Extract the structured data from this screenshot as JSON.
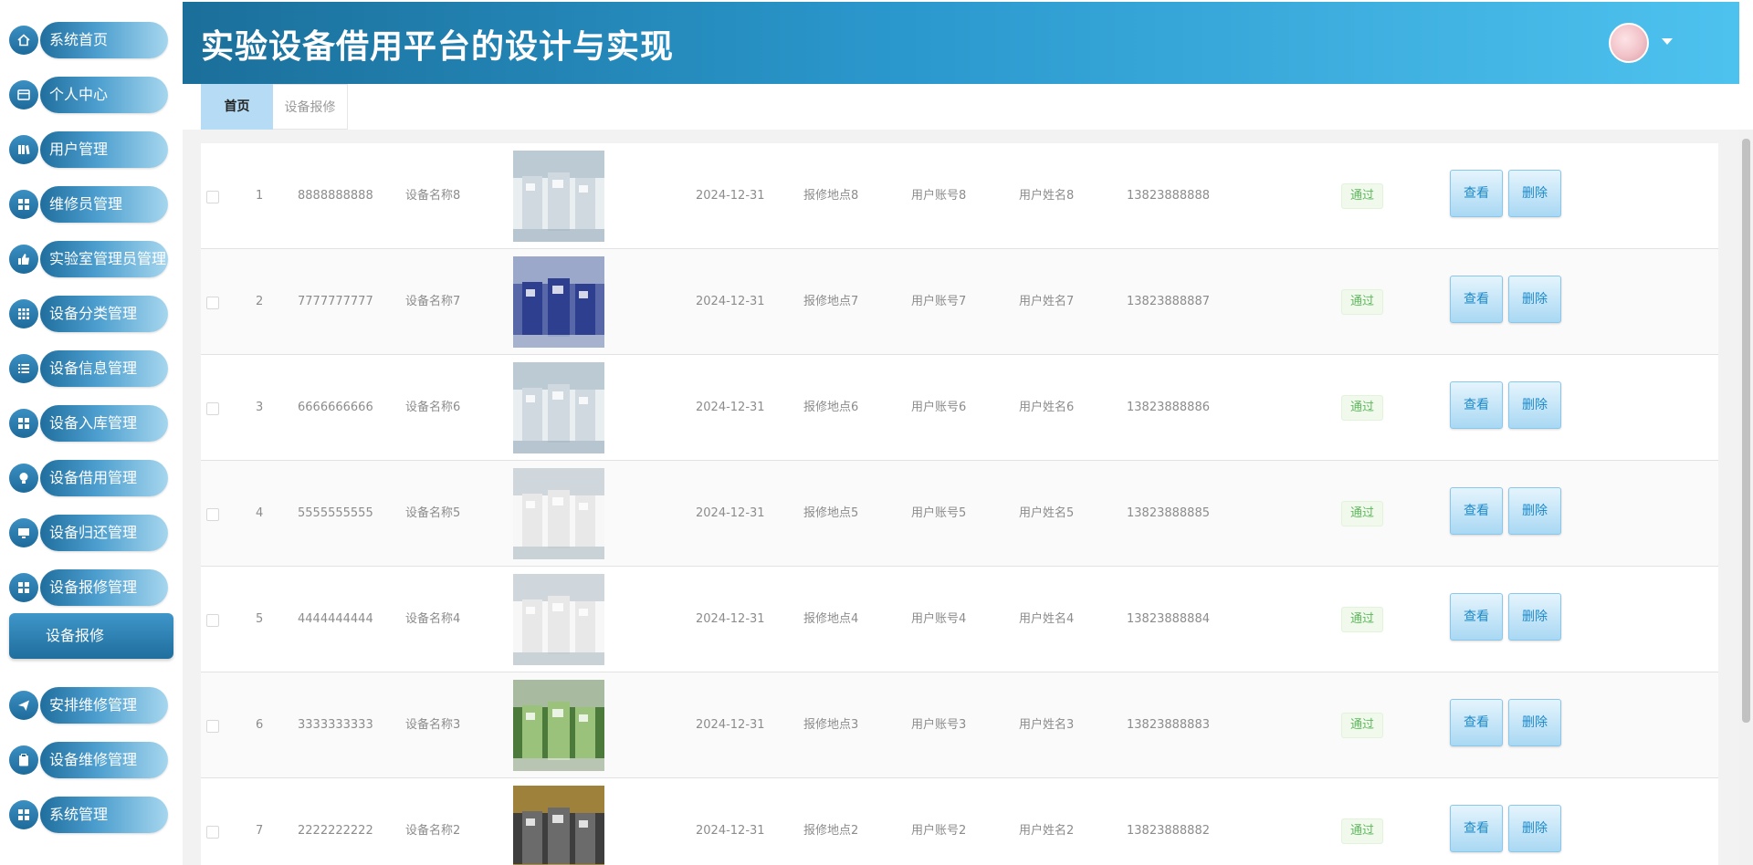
{
  "header": {
    "title": "实验设备借用平台的设计与实现"
  },
  "sidebar": {
    "items": [
      {
        "label": "系统首页",
        "icon": "home-icon"
      },
      {
        "label": "个人中心",
        "icon": "profile-card-icon"
      },
      {
        "label": "用户管理",
        "icon": "books-icon"
      },
      {
        "label": "维修员管理",
        "icon": "grid-icon"
      },
      {
        "label": "实验室管理员管理",
        "icon": "thumbs-up-icon"
      },
      {
        "label": "设备分类管理",
        "icon": "apps-icon"
      },
      {
        "label": "设备信息管理",
        "icon": "list-icon"
      },
      {
        "label": "设备入库管理",
        "icon": "grid-icon"
      },
      {
        "label": "设备借用管理",
        "icon": "bulb-icon"
      },
      {
        "label": "设备归还管理",
        "icon": "monitor-icon"
      },
      {
        "label": "设备报修管理",
        "icon": "grid-icon"
      },
      {
        "label": "安排维修管理",
        "icon": "send-icon"
      },
      {
        "label": "设备维修管理",
        "icon": "clipboard-icon"
      },
      {
        "label": "系统管理",
        "icon": "grid-icon"
      }
    ],
    "submenu": {
      "label": "设备报修"
    }
  },
  "tabs": [
    {
      "label": "首页",
      "active": true
    },
    {
      "label": "设备报修",
      "active": false
    }
  ],
  "table": {
    "rows": [
      {
        "index": "1",
        "code": "8888888888",
        "name": "设备名称8",
        "date": "2024-12-31",
        "location": "报修地点8",
        "account": "用户账号8",
        "username": "用户姓名8",
        "phone": "13823888888",
        "status": "通过"
      },
      {
        "index": "2",
        "code": "7777777777",
        "name": "设备名称7",
        "date": "2024-12-31",
        "location": "报修地点7",
        "account": "用户账号7",
        "username": "用户姓名7",
        "phone": "13823888887",
        "status": "通过"
      },
      {
        "index": "3",
        "code": "6666666666",
        "name": "设备名称6",
        "date": "2024-12-31",
        "location": "报修地点6",
        "account": "用户账号6",
        "username": "用户姓名6",
        "phone": "13823888886",
        "status": "通过"
      },
      {
        "index": "4",
        "code": "5555555555",
        "name": "设备名称5",
        "date": "2024-12-31",
        "location": "报修地点5",
        "account": "用户账号5",
        "username": "用户姓名5",
        "phone": "13823888885",
        "status": "通过"
      },
      {
        "index": "5",
        "code": "4444444444",
        "name": "设备名称4",
        "date": "2024-12-31",
        "location": "报修地点4",
        "account": "用户账号4",
        "username": "用户姓名4",
        "phone": "13823888884",
        "status": "通过"
      },
      {
        "index": "6",
        "code": "3333333333",
        "name": "设备名称3",
        "date": "2024-12-31",
        "location": "报修地点3",
        "account": "用户账号3",
        "username": "用户姓名3",
        "phone": "13823888883",
        "status": "通过"
      },
      {
        "index": "7",
        "code": "2222222222",
        "name": "设备名称2",
        "date": "2024-12-31",
        "location": "报修地点2",
        "account": "用户账号2",
        "username": "用户姓名2",
        "phone": "13823888882",
        "status": "通过"
      }
    ],
    "view_label": "查看",
    "delete_label": "删除"
  },
  "colors": {
    "accent": "#2a97cc",
    "sidebar_dark": "#1f6e9e",
    "tab_active": "#b6dcf5",
    "status_green": "#5cb85c"
  }
}
